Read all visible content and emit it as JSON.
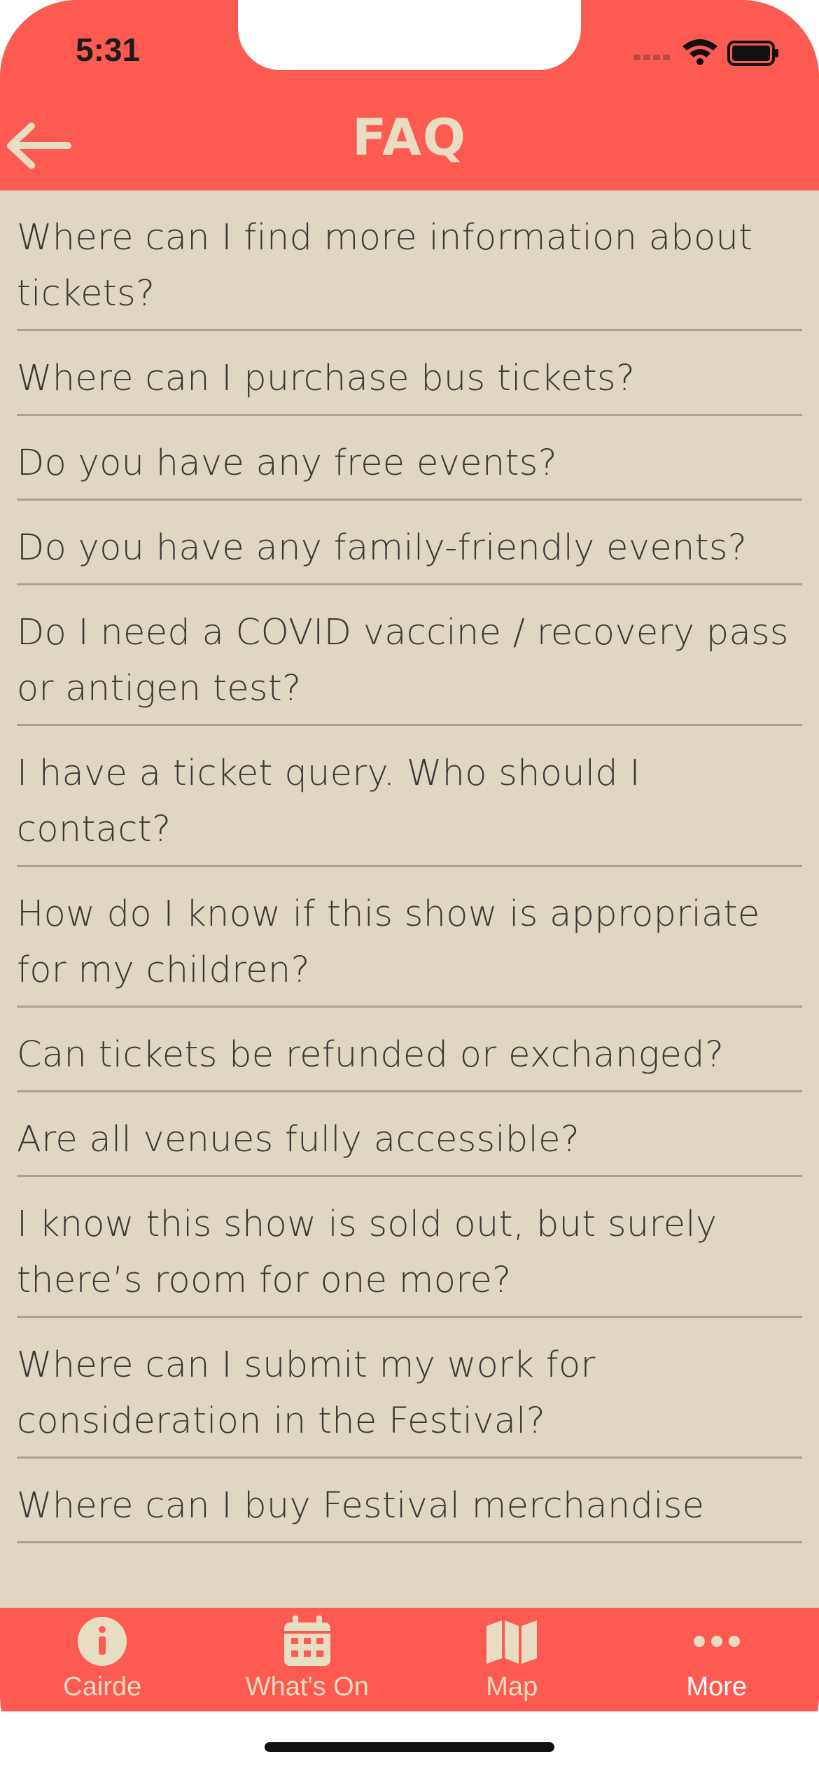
{
  "status_bar": {
    "time": "5:31"
  },
  "header": {
    "title": "FAQ"
  },
  "faq": [
    "Where can I find more information about tickets?",
    "Where can I purchase bus tickets?",
    "Do you have any free events?",
    "Do you have any family-friendly events?",
    "Do I need a COVID vaccine / recovery pass or antigen test?",
    "I have a ticket query. Who should I contact?",
    "How do I know if this show is appropriate for my children?",
    "Can tickets be refunded or exchanged?",
    "Are all venues fully accessible?",
    "I know this show is sold out, but surely there’s room for one more?",
    "Where can I submit my work for consideration in the Festival?",
    "Where can I buy Festival merchandise"
  ],
  "tabbar": {
    "tabs": [
      {
        "label": "Cairde",
        "icon": "info-icon"
      },
      {
        "label": "What's On",
        "icon": "calendar-icon"
      },
      {
        "label": "Map",
        "icon": "map-icon"
      },
      {
        "label": "More",
        "icon": "more-icon",
        "active": true
      }
    ]
  },
  "colors": {
    "accent": "#fd5a51",
    "background": "#e0d7c3",
    "header_text": "#e8dcc3",
    "body_text": "#3a3835"
  }
}
